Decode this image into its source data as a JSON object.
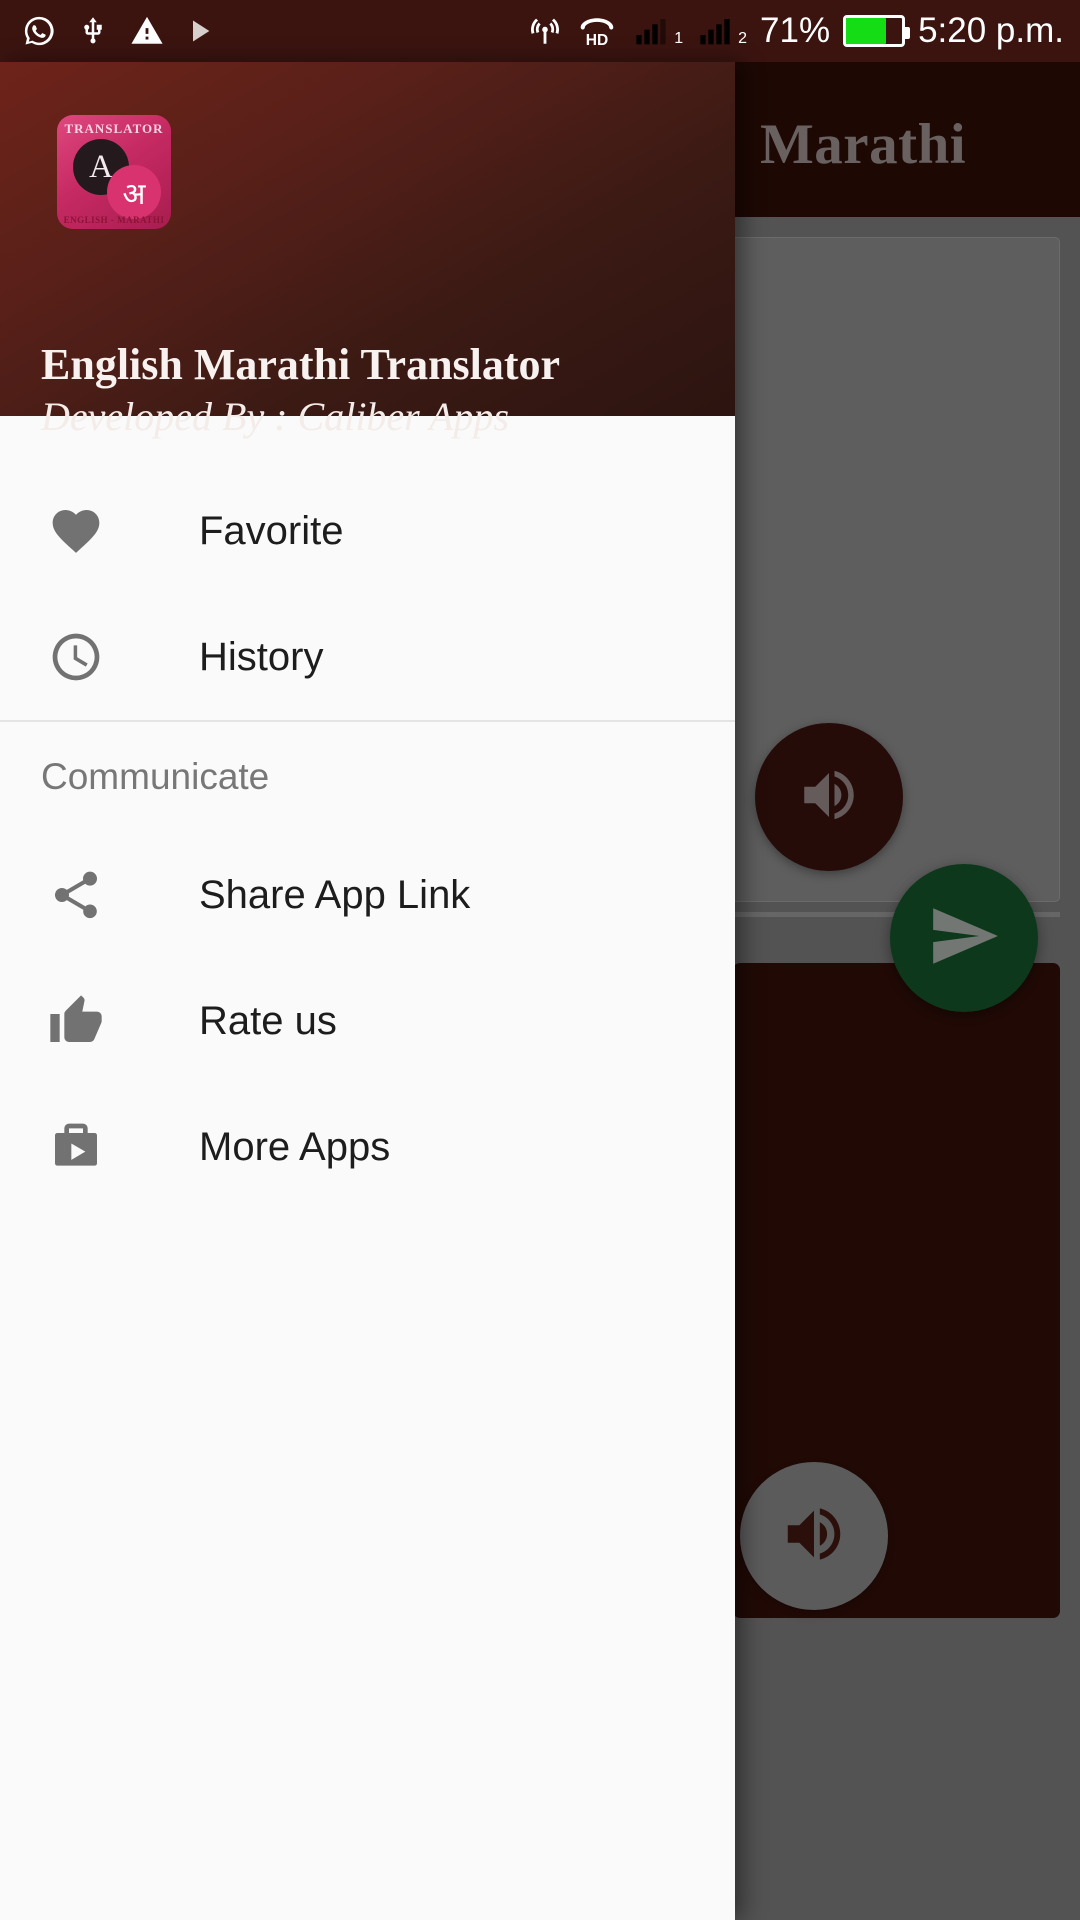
{
  "status_bar": {
    "icons_left": [
      "whatsapp-icon",
      "usb-icon",
      "warning-icon",
      "play-icon"
    ],
    "hotspot_icon": "hotspot-icon",
    "hd_label": "HD",
    "sim1_label": "1",
    "sim2_label": "2",
    "battery_percent": "71%",
    "battery_level": 71,
    "battery_color": "#15dd15",
    "time": "5:20 p.m."
  },
  "background_app": {
    "title": "Marathi",
    "speaker_top_icon": "volume-up-icon",
    "speaker_bottom_icon": "volume-up-icon",
    "send_icon": "send-icon",
    "accent_color": "#330e07",
    "send_color": "#17612f"
  },
  "drawer": {
    "app_icon": {
      "name": "app-icon",
      "top_text": "TRANSLATOR",
      "letter_source": "A",
      "letter_target": "अ",
      "bottom_text": "ENGLISH - MARATHI"
    },
    "app_name": "English Marathi Translator",
    "developer": "Developed By : Caliber Apps",
    "items_primary": [
      {
        "icon": "heart-icon",
        "label": "Favorite"
      },
      {
        "icon": "clock-icon",
        "label": "History"
      }
    ],
    "section_communicate": "Communicate",
    "items_communicate": [
      {
        "icon": "share-icon",
        "label": "Share App Link"
      },
      {
        "icon": "thumbs-up-icon",
        "label": "Rate us"
      },
      {
        "icon": "store-play-icon",
        "label": "More Apps"
      }
    ]
  }
}
